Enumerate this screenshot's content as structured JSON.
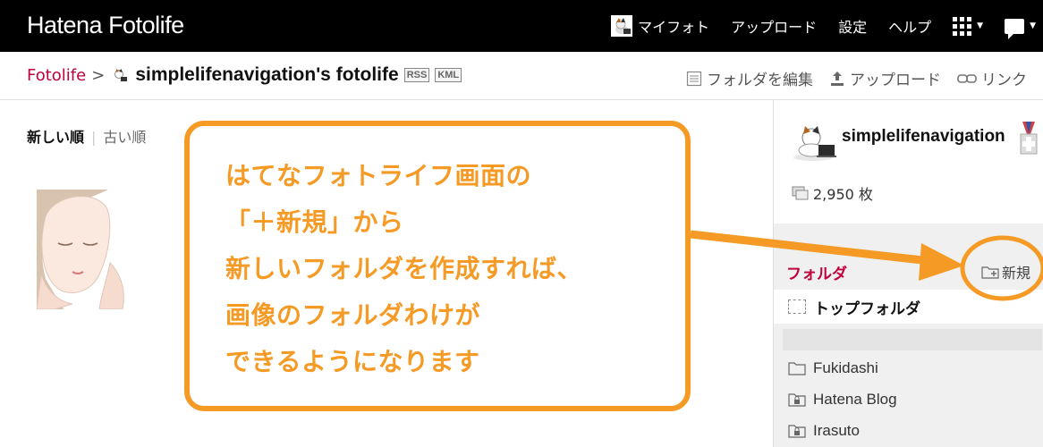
{
  "app": {
    "logo": "Hatena Fotolife"
  },
  "nav": {
    "my_photo": "マイフォト",
    "upload": "アップロード",
    "settings": "設定",
    "help": "ヘルプ"
  },
  "breadcrumb": {
    "root": "Fotolife",
    "separator": ">",
    "title": "simplelifenavigation's fotolife",
    "rss": "RSS",
    "kml": "KML"
  },
  "actions": {
    "edit_folder": "フォルダを編集",
    "upload": "アップロード",
    "link": "リンク"
  },
  "sort": {
    "newest": "新しい順",
    "divider": "|",
    "oldest": "古い順"
  },
  "profile": {
    "name": "simplelifenavigation",
    "count": "2,950 枚"
  },
  "folders": {
    "heading": "フォルダ",
    "new_label": "新規",
    "top_folder": "トップフォルダ",
    "items": [
      {
        "label": "Fukidashi"
      },
      {
        "label": "Hatena Blog"
      },
      {
        "label": "Irasuto"
      }
    ]
  },
  "callout": {
    "lines": [
      "はてなフォトライフ画面の",
      "「＋新規」から",
      "新しいフォルダを作成すれば、",
      "画像のフォルダわけが",
      "できるようになります"
    ]
  },
  "colors": {
    "accent": "#c0003a",
    "callout": "#f59a25",
    "topbar": "#000000"
  }
}
